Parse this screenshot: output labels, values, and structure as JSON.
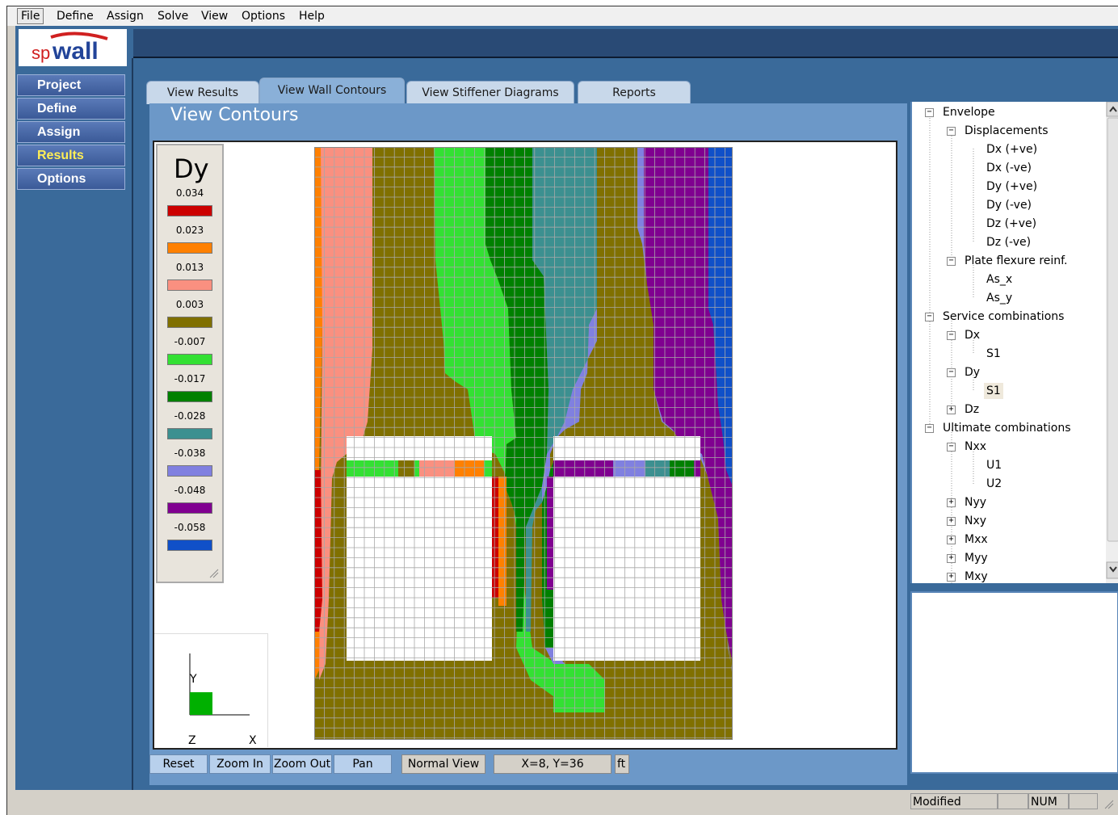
{
  "menu": [
    "File",
    "Define",
    "Assign",
    "Solve",
    "View",
    "Options",
    "Help"
  ],
  "logo": "spWall",
  "nav": [
    {
      "label": "Project"
    },
    {
      "label": "Define"
    },
    {
      "label": "Assign"
    },
    {
      "label": "Results"
    },
    {
      "label": "Options"
    }
  ],
  "tabs": [
    "View Results",
    "View Wall Contours",
    "View Stiffener Diagrams",
    "Reports"
  ],
  "active_tab": "View Wall Contours",
  "panel_title": "View Contours",
  "legend": {
    "title": "Dy",
    "entries": [
      {
        "value": "0.034",
        "color": "#cc0000"
      },
      {
        "value": "0.023",
        "color": "#ff8000"
      },
      {
        "value": "0.013",
        "color": "#fa9080"
      },
      {
        "value": "0.003",
        "color": "#807000"
      },
      {
        "value": "-0.007",
        "color": "#33e033"
      },
      {
        "value": "-0.017",
        "color": "#008000"
      },
      {
        "value": "-0.028",
        "color": "#3c9090"
      },
      {
        "value": "-0.038",
        "color": "#8080e0"
      },
      {
        "value": "-0.048",
        "color": "#800090"
      },
      {
        "value": "-0.058",
        "color": "#1050c8"
      }
    ]
  },
  "axes": {
    "y": "Y",
    "z": "Z",
    "x": "X"
  },
  "toolbar": {
    "reset": "Reset",
    "zoom_in": "Zoom In",
    "zoom_out": "Zoom Out",
    "pan": "Pan",
    "view_mode": "Normal View",
    "coords": "X=8, Y=36",
    "unit": "ft"
  },
  "tree": {
    "envelope": "Envelope",
    "displacements": "Displacements",
    "dx_pos": "Dx (+ve)",
    "dx_neg": "Dx (-ve)",
    "dy_pos": "Dy (+ve)",
    "dy_neg": "Dy (-ve)",
    "dz_pos": "Dz (+ve)",
    "dz_neg": "Dz (-ve)",
    "plate_flexure": "Plate flexure reinf.",
    "as_x": "As_x",
    "as_y": "As_y",
    "service": "Service combinations",
    "svc_dx": "Dx",
    "svc_dx_s1": "S1",
    "svc_dy": "Dy",
    "svc_dy_s1": "S1",
    "svc_dz": "Dz",
    "ultimate": "Ultimate combinations",
    "nxx": "Nxx",
    "u1": "U1",
    "u2": "U2",
    "nyy": "Nyy",
    "nxy": "Nxy",
    "mxx": "Mxx",
    "myy": "Myy",
    "mxy": "Mxy"
  },
  "status": {
    "modified": "Modified",
    "num": "NUM"
  }
}
